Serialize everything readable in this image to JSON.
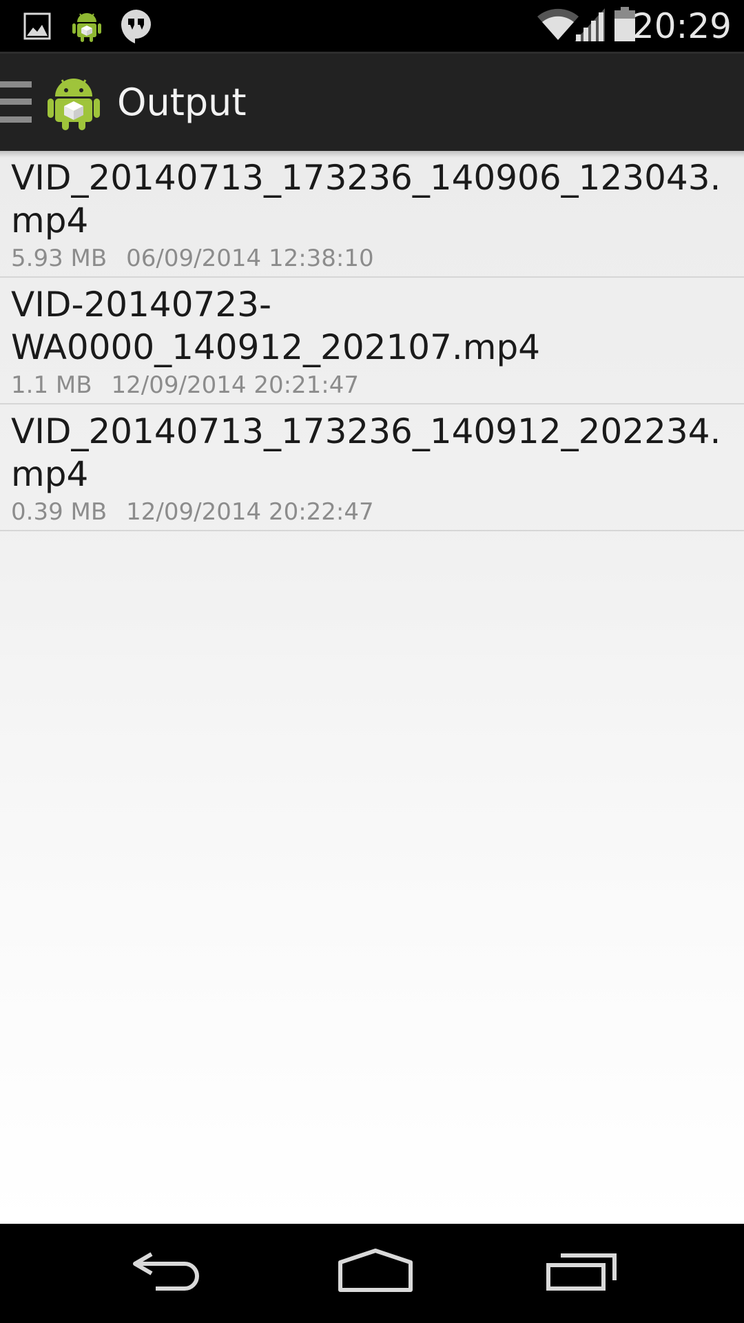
{
  "status_bar": {
    "time": "20:29",
    "notification_icons": [
      "gallery-icon",
      "android-app-icon",
      "hangouts-icon"
    ],
    "system_icons": [
      "wifi-icon",
      "cell-signal-icon",
      "battery-icon"
    ]
  },
  "action_bar": {
    "title": "Output",
    "background": "#222222",
    "icons": [
      "menu-icon",
      "app-icon"
    ]
  },
  "files": [
    {
      "name": "VID_20140713_173236_140906_123043.mp4",
      "size": "5.93 MB",
      "date": "06/09/2014 12:38:10"
    },
    {
      "name": "VID-20140723-WA0000_140912_202107.mp4",
      "size": "1.1 MB",
      "date": "12/09/2014 20:21:47"
    },
    {
      "name": "VID_20140713_173236_140912_202234.mp4",
      "size": "0.39 MB",
      "date": "12/09/2014 20:22:47"
    }
  ],
  "nav_bar": {
    "buttons": [
      "back-icon",
      "home-icon",
      "recents-icon"
    ]
  },
  "colors": {
    "android_green": "#9fc43b",
    "title_text": "#f2f2f2",
    "meta_text": "#8c8c8c"
  }
}
